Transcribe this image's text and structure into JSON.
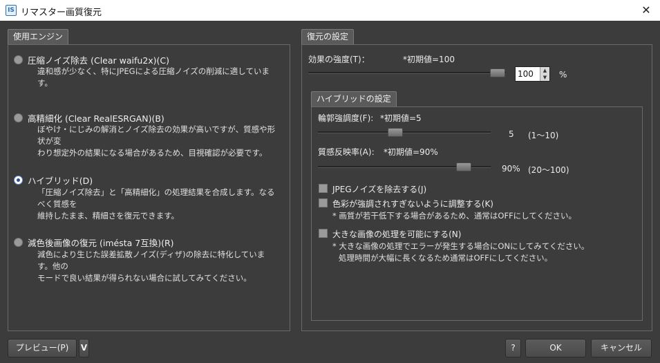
{
  "window": {
    "title": "リマスター画質復元",
    "icon": "IS"
  },
  "engine": {
    "tab_label": "使用エンジン",
    "options": [
      {
        "label": "圧縮ノイズ除去 (Clear waifu2x)(C)",
        "selected": false,
        "desc": [
          "違和感が少なく、特にJPEGによる圧縮ノイズの削減に適しています。"
        ]
      },
      {
        "label": "高精細化 (Clear RealESRGAN)(B)",
        "selected": false,
        "desc": [
          "ぼやけ・にじみの解消とノイズ除去の効果が高いですが、質感や形状が変",
          "わり想定外の結果になる場合があるため、目視確認が必要です。"
        ]
      },
      {
        "label": "ハイブリッド(D)",
        "selected": true,
        "desc": [
          "「圧縮ノイズ除去」と「高精細化」の処理結果を合成します。なるべく質感を",
          "維持したまま、精細さを復元できます。"
        ]
      },
      {
        "label": "減色後画像の復元 (iméstа 7互換)(R)",
        "selected": false,
        "desc": [
          "減色により生じた誤差拡散ノイズ(ディザ)の除去に特化しています。他の",
          "モードで良い結果が得られない場合に試してみてください。"
        ]
      }
    ]
  },
  "restore": {
    "tab_label": "復元の設定",
    "strength": {
      "label": "効果の強度(T)：",
      "default_note": "*初期値=100",
      "value": "100",
      "unit": "%",
      "level": 100
    },
    "hybrid": {
      "tab_label": "ハイブリッドの設定",
      "edge": {
        "label": "輪郭強調度(F):",
        "default_note": "*初期値=5",
        "value": "5",
        "range": "(1〜10)",
        "level": 5,
        "min": 1,
        "max": 10
      },
      "texture": {
        "label": "質感反映率(A):",
        "default_note": "*初期値=90%",
        "value": "90%",
        "range": "(20〜100)",
        "level": 90,
        "min": 20,
        "max": 100
      }
    },
    "options": {
      "jpeg_noise": {
        "label": "JPEGノイズを除去する(J)",
        "checked": false
      },
      "color_adjust": {
        "label": "色彩が強調されすぎないように調整する(K)",
        "checked": false,
        "note": "* 画質が若干低下する場合があるため、通常はOFFにしてください。"
      },
      "large_image": {
        "label": "大きな画像の処理を可能にする(N)",
        "checked": false,
        "note_lines": [
          "* 大きな画像の処理でエラーが発生する場合にONにしてみてください。",
          "処理時間が大幅に長くなるため通常はOFFにしてください。"
        ]
      }
    }
  },
  "footer": {
    "preview_label": "プレビュー(P)",
    "preview_dropdown": "V",
    "help_label": "?",
    "ok_label": "OK",
    "cancel_label": "キャンセル"
  }
}
